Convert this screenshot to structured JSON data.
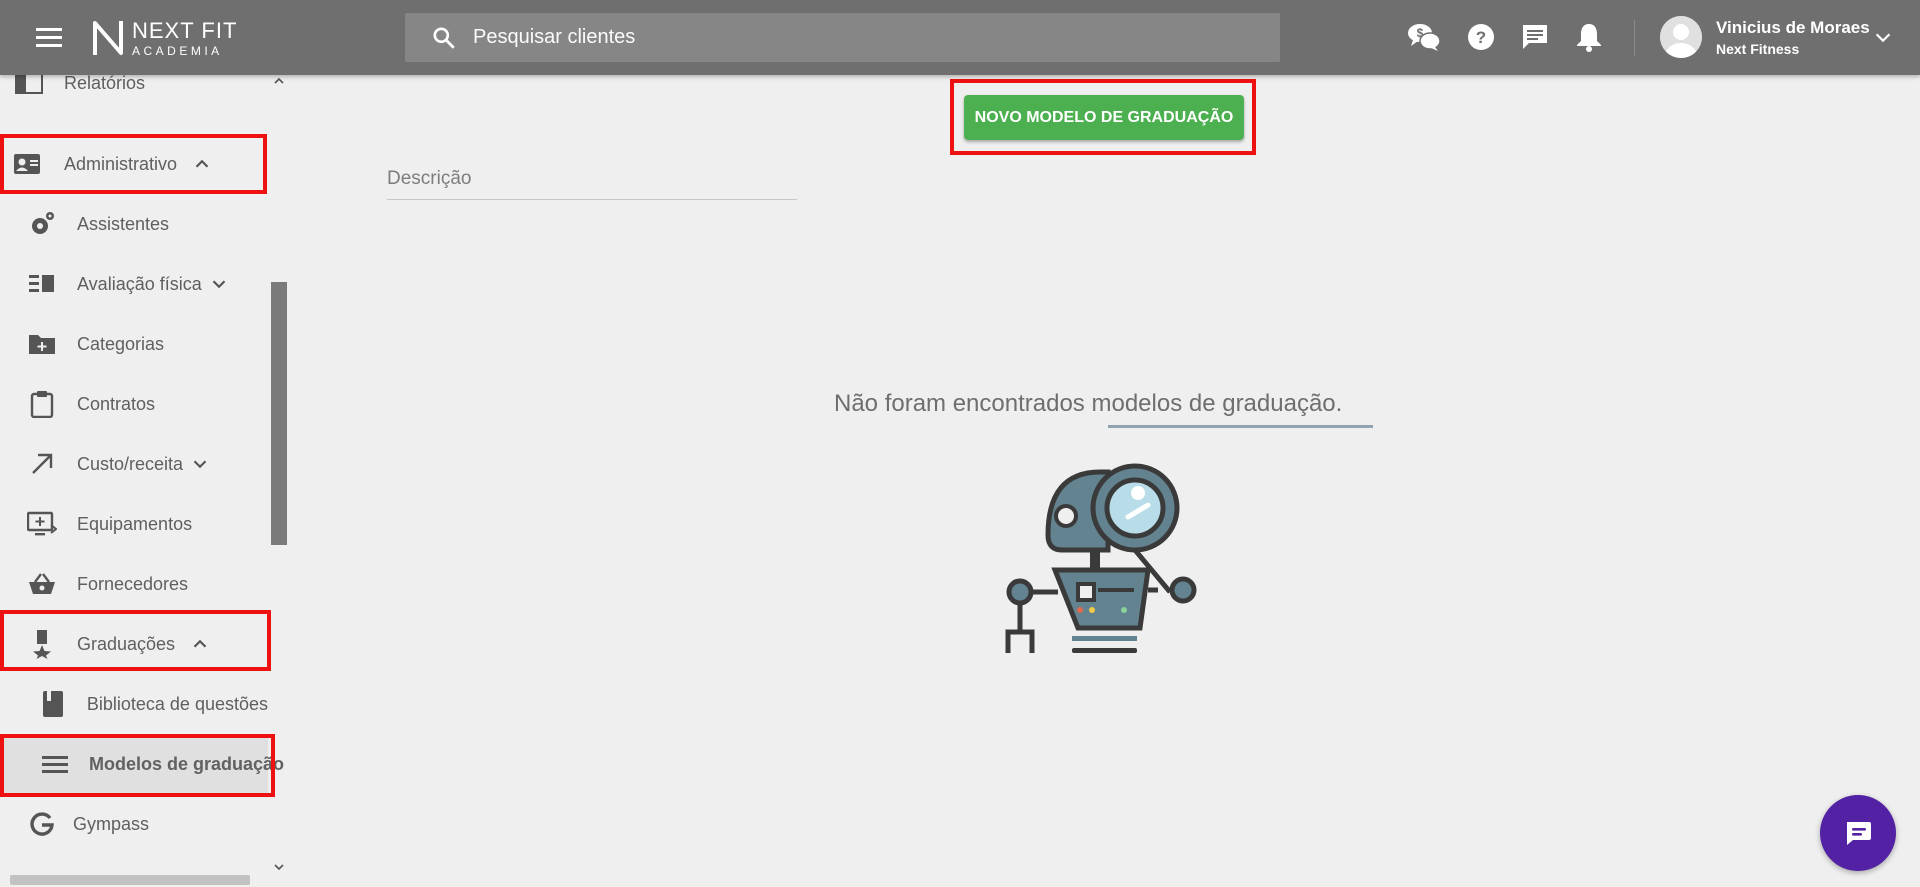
{
  "header": {
    "logo_line1": "NEXT FIT",
    "logo_line2": "ACADEMIA",
    "search_placeholder": "Pesquisar clientes",
    "user_name": "Vinicius de Moraes",
    "user_org": "Next Fitness"
  },
  "sidebar": {
    "items": {
      "relatorios": "Relatórios",
      "administrativo": "Administrativo",
      "assistentes": "Assistentes",
      "avaliacao": "Avaliação física",
      "categorias": "Categorias",
      "contratos": "Contratos",
      "custo": "Custo/receita",
      "equipamentos": "Equipamentos",
      "fornecedores": "Fornecedores",
      "graduacoes": "Graduações",
      "biblioteca": "Biblioteca de questões",
      "modelos": "Modelos de graduação",
      "gympass": "Gympass"
    }
  },
  "main": {
    "new_button": "NOVO MODELO DE GRADUAÇÃO",
    "description_placeholder": "Descrição",
    "empty_message": "Não foram encontrados modelos de graduação."
  },
  "colors": {
    "topbar": "#6f6f6f",
    "accent_green": "#4caf50",
    "highlight_red": "#ee1111",
    "chat_purple": "#5321a3"
  }
}
